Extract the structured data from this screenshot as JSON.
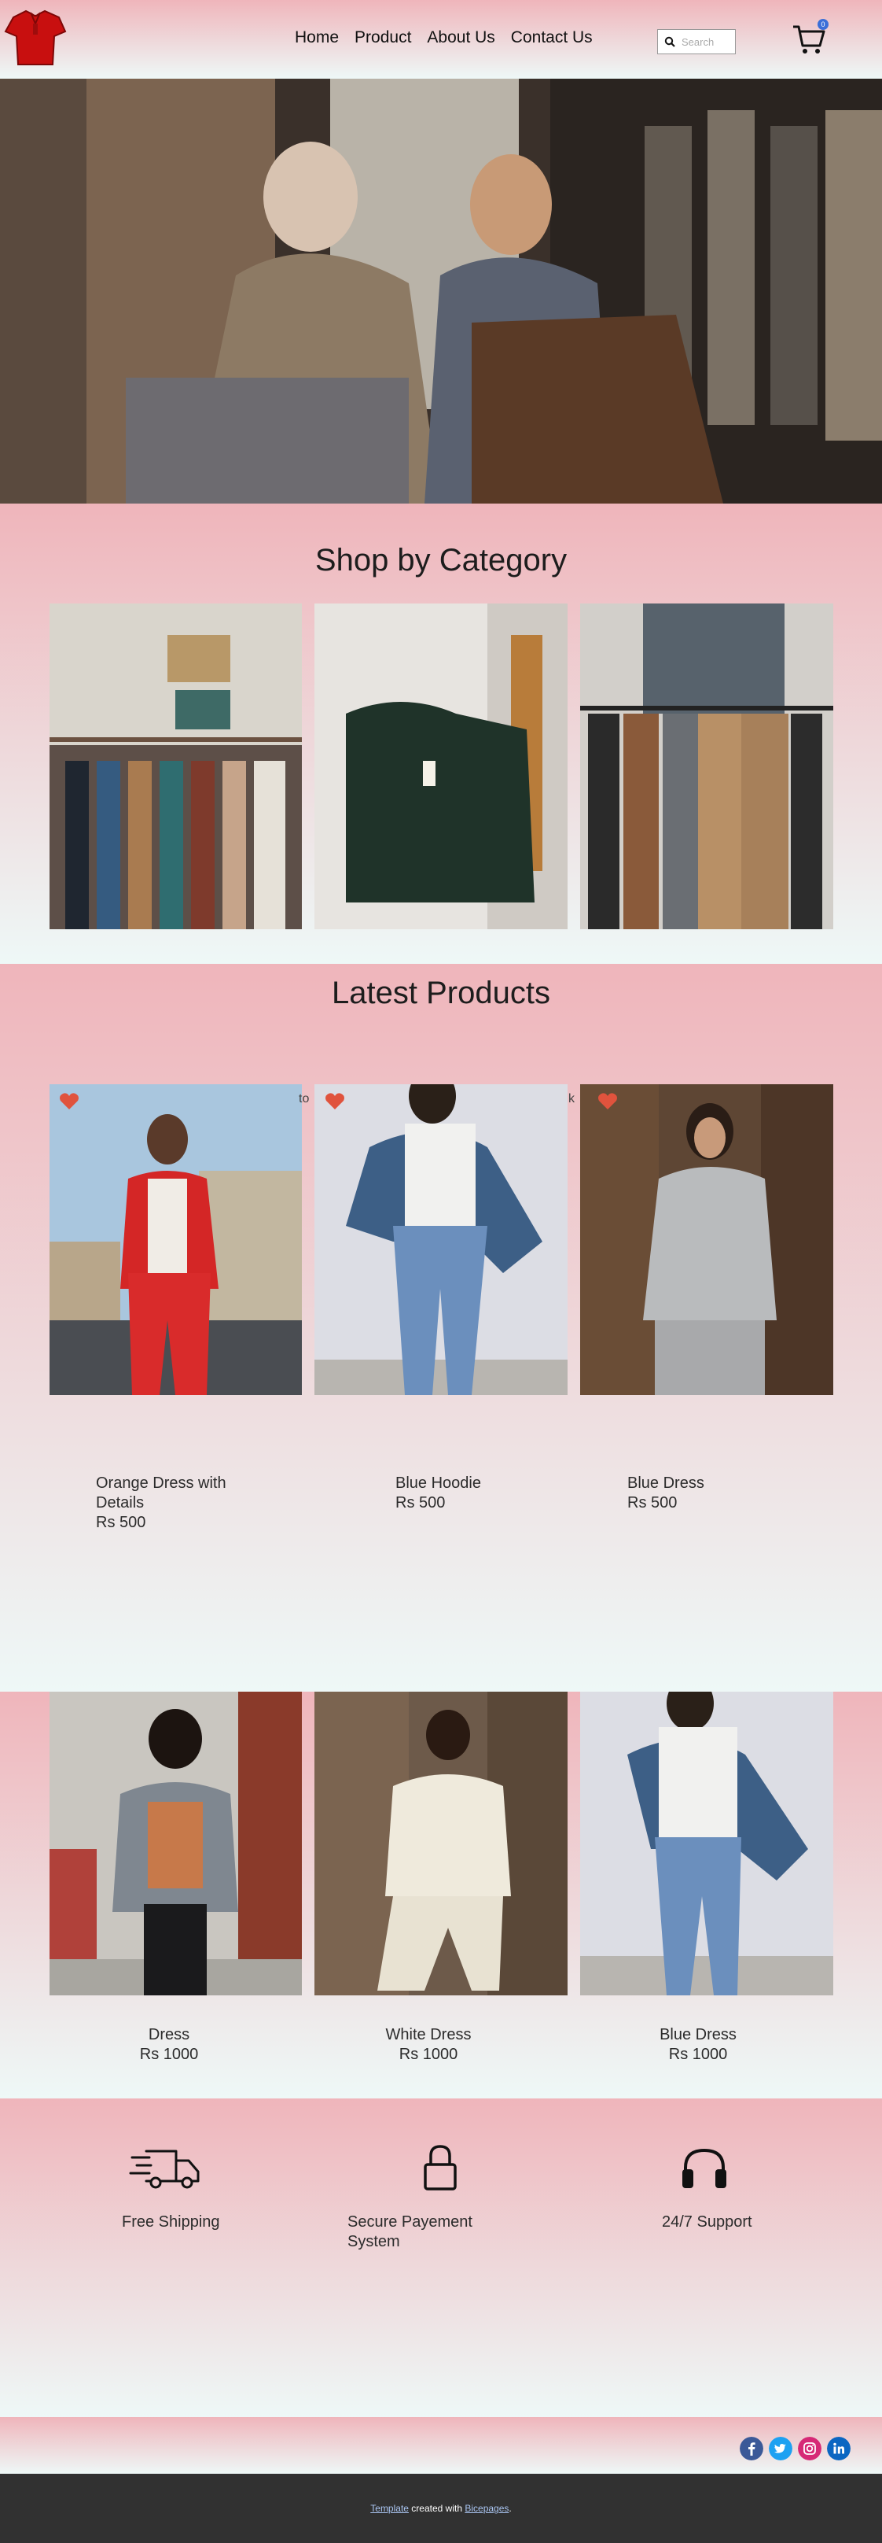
{
  "nav": {
    "items": [
      "Home",
      "Product",
      "About Us",
      "Contact Us"
    ],
    "search_placeholder": "Search",
    "cart_count": "0"
  },
  "category": {
    "title": "Shop by Category"
  },
  "latest": {
    "title": "Latest Products",
    "fragments": [
      "to",
      "k"
    ],
    "products": [
      {
        "name": "Orange Dress with Details",
        "price": "Rs 500"
      },
      {
        "name": "Blue Hoodie",
        "price": "Rs 500"
      },
      {
        "name": "Blue Dress",
        "price": "Rs 500"
      }
    ]
  },
  "row2": {
    "products": [
      {
        "name": "Dress",
        "price": "Rs 1000"
      },
      {
        "name": "White Dress",
        "price": "Rs 1000"
      },
      {
        "name": "Blue Dress",
        "price": "Rs 1000"
      }
    ]
  },
  "features": [
    {
      "icon": "truck-icon",
      "label": "Free Shipping"
    },
    {
      "icon": "lock-icon",
      "label": "Secure Payement System"
    },
    {
      "icon": "headphones-icon",
      "label": "24/7 Support"
    }
  ],
  "social": [
    "facebook-icon",
    "twitter-icon",
    "instagram-icon",
    "linkedin-icon"
  ],
  "footer": {
    "prefix": "Template",
    "middle": " created with ",
    "link": "Bicepages",
    "suffix": "."
  },
  "colors": {
    "heart": "#e0533d",
    "footer_bg": "#313131",
    "facebook": "#3b5998",
    "twitter": "#1da1f2",
    "instagram": "#d62976",
    "linkedin": "#0a66c2"
  }
}
